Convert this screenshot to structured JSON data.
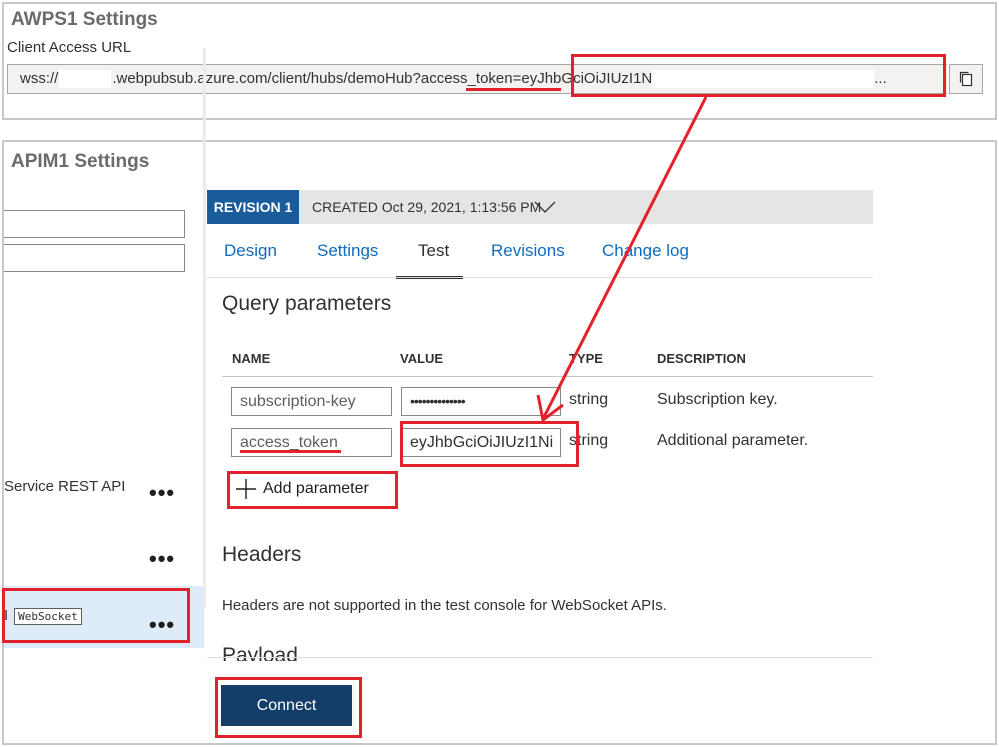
{
  "awps": {
    "title": "AWPS1 Settings",
    "client_access_label": "Client Access URL",
    "url_prefix": "wss://",
    "url_middle": ".webpubsub.azure.com/client/hubs/demoHub?",
    "url_param": "access_token",
    "url_eq": "=",
    "url_token": "eyJhbGciOiJIUzI1N",
    "url_ellipsis": "..."
  },
  "apim": {
    "title": "APIM1 Settings",
    "sidebar": {
      "items": [
        {
          "label": "Service REST API",
          "more": "•••"
        },
        {
          "label": "",
          "more": "•••"
        },
        {
          "label": "I",
          "badge": "WebSocket",
          "more": "•••"
        }
      ]
    },
    "revision": {
      "badge": "REVISION 1",
      "created": "CREATED Oct 29, 2021, 1:13:56 PM"
    },
    "tabs": [
      "Design",
      "Settings",
      "Test",
      "Revisions",
      "Change log"
    ],
    "active_tab": "Test",
    "query": {
      "heading": "Query parameters",
      "columns": [
        "NAME",
        "VALUE",
        "TYPE",
        "DESCRIPTION"
      ],
      "rows": [
        {
          "name": "subscription-key",
          "value": "••••••••••••••",
          "type": "string",
          "description": "Subscription key."
        },
        {
          "name": "access_token",
          "value": "eyJhbGciOiJIUzI1Ni",
          "type": "string",
          "description": "Additional parameter."
        }
      ],
      "add_label": "Add parameter"
    },
    "headers": {
      "heading": "Headers",
      "note": "Headers are not supported in the test console for WebSocket APIs."
    },
    "payload_heading": "Payload",
    "connect_label": "Connect"
  },
  "colors": {
    "annotation_red": "#e3212b",
    "revision_blue": "#195b9b",
    "connect_navy": "#123e69",
    "link_blue": "#0f6cbd",
    "selected_row": "#deecf9"
  },
  "icons": [
    "copy-icon",
    "chevron-down-icon",
    "plus-icon",
    "more-icon"
  ]
}
